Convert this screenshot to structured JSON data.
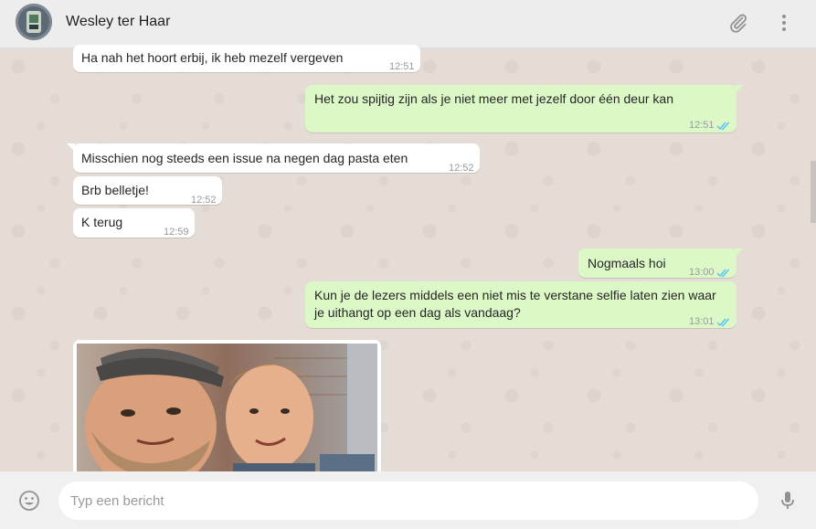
{
  "header": {
    "contact_name": "Wesley ter Haar"
  },
  "icons": {
    "attach": "paperclip-icon",
    "menu": "more-vertical-icon",
    "emoji": "smiley-icon",
    "mic": "microphone-icon"
  },
  "colors": {
    "incoming": "#ffffff",
    "outgoing": "#dcf8c6",
    "read_ticks": "#4fc3f7",
    "chat_bg": "#e5ddd5"
  },
  "messages": [
    {
      "direction": "in",
      "text": "Ha nah het hoort erbij, ik heb mezelf vergeven",
      "time": "12:51"
    },
    {
      "direction": "out",
      "text": "Het zou spijtig zijn als je niet meer met jezelf door één deur kan",
      "time": "12:51",
      "status": "read"
    },
    {
      "direction": "in",
      "text": "Misschien nog steeds een issue na negen dag pasta eten",
      "time": "12:52"
    },
    {
      "direction": "in",
      "text": "Brb belletje!",
      "time": "12:52"
    },
    {
      "direction": "in",
      "text": "K terug",
      "time": "12:59"
    },
    {
      "direction": "out",
      "text": "Nogmaals hoi",
      "time": "13:00",
      "status": "read"
    },
    {
      "direction": "out",
      "text": "Kun je de lezers middels een niet mis te verstane selfie laten zien waar je uithangt op een dag als vandaag?",
      "time": "13:01",
      "status": "read"
    },
    {
      "direction": "in",
      "type": "image",
      "description": "selfie"
    }
  ],
  "composer": {
    "placeholder": "Typ een bericht"
  }
}
